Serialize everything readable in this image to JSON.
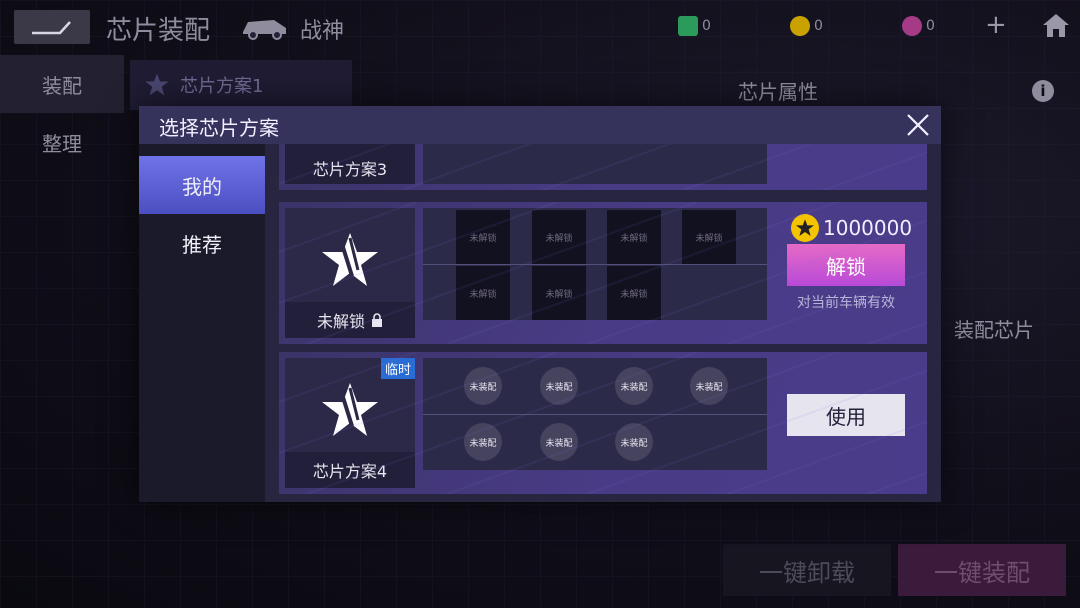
{
  "background": {
    "title": "芯片装配",
    "car_name": "战神",
    "resources": [
      {
        "icon": "ticket-icon",
        "value": "0",
        "color": "#3fd07a"
      },
      {
        "icon": "star-coin-icon",
        "value": "0",
        "color": "#f5c400"
      },
      {
        "icon": "star-gem-icon",
        "value": "0",
        "color": "#e04fb0"
      }
    ],
    "left_tabs": [
      "装配",
      "整理"
    ],
    "current_plan": "芯片方案1",
    "attr_label": "芯片属性",
    "equip_chip_label": "装配芯片",
    "unload_all": "一键卸载",
    "equip_all": "一键装配"
  },
  "modal": {
    "title": "选择芯片方案",
    "tabs": [
      "我的",
      "推荐"
    ],
    "plans": {
      "partial": {
        "name": "芯片方案3"
      },
      "locked": {
        "status": "未解锁",
        "slot_label": "未解锁",
        "price": "1000000",
        "unlock_label": "解锁",
        "hint": "对当前车辆有效"
      },
      "temp": {
        "name": "芯片方案4",
        "badge": "临时",
        "slot_label": "未装配",
        "use_label": "使用"
      }
    }
  }
}
